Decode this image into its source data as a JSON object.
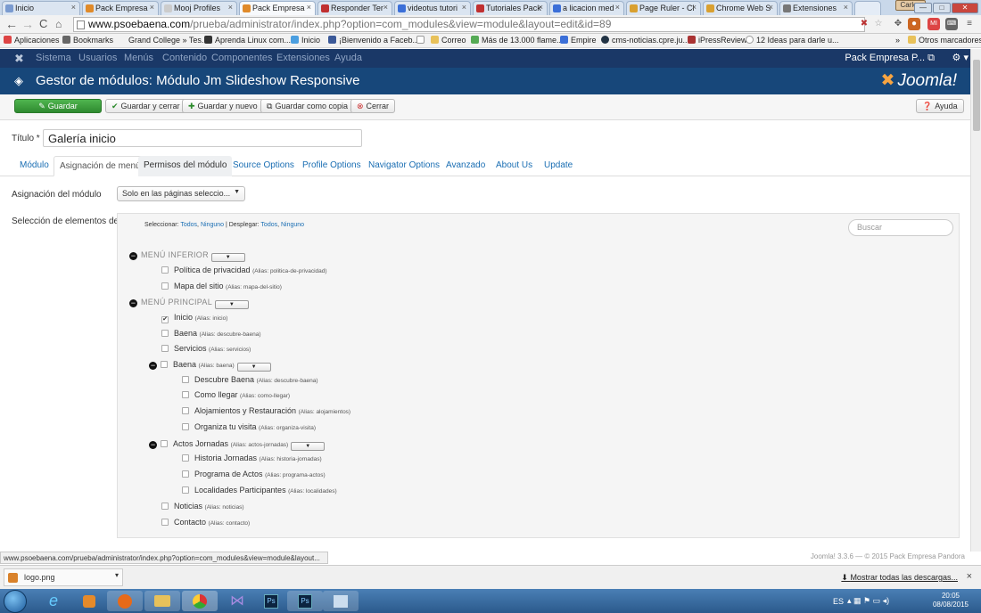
{
  "browser": {
    "tabs": [
      {
        "label": "Inicio"
      },
      {
        "label": "Pack Empresa"
      },
      {
        "label": "Mooj Profiles"
      },
      {
        "label": "Pack Empresa"
      },
      {
        "label": "Responder Ter"
      },
      {
        "label": "videotus tutori"
      },
      {
        "label": "Tutoriales Pack"
      },
      {
        "label": "a licacion med"
      },
      {
        "label": "Page Ruler - Cl"
      },
      {
        "label": "Chrome Web S"
      },
      {
        "label": "Extensiones"
      }
    ],
    "user_badge": "Carlos",
    "url_host": "www.psoebaena.com",
    "url_path": "/prueba/administrator/index.php?option=com_modules&view=module&layout=edit&id=89",
    "bookmarks": [
      "Aplicaciones",
      "Bookmarks",
      "Grand College » Tes...",
      "Aprenda Linux com...",
      "Inicio",
      "¡Bienvenido a Faceb...",
      "",
      "Correo",
      "Más de 13.000 flame...",
      "Empire",
      "cms-noticias.cpre.ju...",
      "iPressReview",
      "12 Ideas para darle u..."
    ],
    "other_bookmarks": "Otros marcadores",
    "more_bookmarks": "»"
  },
  "joomla": {
    "menu": [
      "Sistema",
      "Usuarios",
      "Menús",
      "Contenido",
      "Componentes",
      "Extensiones",
      "Ayuda"
    ],
    "site_name": "Pack Empresa P...",
    "page_title": "Gestor de módulos: Módulo Jm Slideshow Responsive",
    "brand": "Joomla!",
    "toolbar": {
      "save": "Guardar",
      "save_close": "Guardar y cerrar",
      "save_new": "Guardar y nuevo",
      "save_copy": "Guardar como copia",
      "close": "Cerrar",
      "help": "Ayuda"
    },
    "title_label": "Título *",
    "title_value": "Galería inicio",
    "tabs": [
      "Módulo",
      "Asignación de menú",
      "Permisos del módulo",
      "Source Options",
      "Profile Options",
      "Navigator Options",
      "Avanzado",
      "About Us",
      "Update"
    ],
    "assignment_label": "Asignación del módulo",
    "assignment_value": "Solo en las páginas seleccio...",
    "selection_label": "Selección de elementos del menú:",
    "select_prefix": "Seleccionar:",
    "select_all": "Todos",
    "select_none": "Ninguno",
    "expand_prefix": "Desplegar:",
    "expand_all": "Todos",
    "expand_none": "Ninguno",
    "search_placeholder": "Buscar",
    "menus": [
      {
        "heading": "MENÚ INFERIOR",
        "items": [
          {
            "label": "Política de privacidad",
            "alias": "(Alias: politica-de-privacidad)"
          },
          {
            "label": "Mapa del sitio",
            "alias": "(Alias: mapa-del-sitio)"
          }
        ]
      },
      {
        "heading": "MENÚ PRINCIPAL",
        "items": [
          {
            "label": "Inicio",
            "alias": "(Alias: inicio)",
            "checked": true
          },
          {
            "label": "Baena",
            "alias": "(Alias: descubre-baena)"
          },
          {
            "label": "Servicios",
            "alias": "(Alias: servicios)"
          },
          {
            "label": "Baena",
            "alias": "(Alias: baena)"
          },
          {
            "label": "Descubre Baena",
            "alias": "(Alias: descubre-baena)"
          },
          {
            "label": "Como llegar",
            "alias": "(Alias: como-llegar)"
          },
          {
            "label": "Alojamientos y Restauración",
            "alias": "(Alias: alojamientos)"
          },
          {
            "label": "Organiza tu visita",
            "alias": "(Alias: organiza-visita)"
          },
          {
            "label": "Actos Jornadas",
            "alias": "(Alias: actos-jornadas)"
          },
          {
            "label": "Historia Jornadas",
            "alias": "(Alias: historia-jornadas)"
          },
          {
            "label": "Programa de Actos",
            "alias": "(Alias: programa-actos)"
          },
          {
            "label": "Localidades Participantes",
            "alias": "(Alias: localidades)"
          },
          {
            "label": "Noticias",
            "alias": "(Alias: noticias)"
          },
          {
            "label": "Contacto",
            "alias": "(Alias: contacto)"
          }
        ]
      }
    ],
    "footer": "Joomla! 3.3.6 — © 2015 Pack Empresa Pandora"
  },
  "status_url": "www.psoebaena.com/prueba/administrator/index.php?option=com_modules&view=module&layout...",
  "downloads": {
    "file": "logo.png",
    "show_all": "Mostrar todas las descargas..."
  },
  "taskbar": {
    "lang": "ES",
    "time": "20:05",
    "date": "08/08/2015"
  },
  "colors": {
    "nav_bg": "#1a3867",
    "header_bg": "#17477a",
    "save_green": "#2f8a30",
    "link_blue": "#1a6eb3"
  }
}
